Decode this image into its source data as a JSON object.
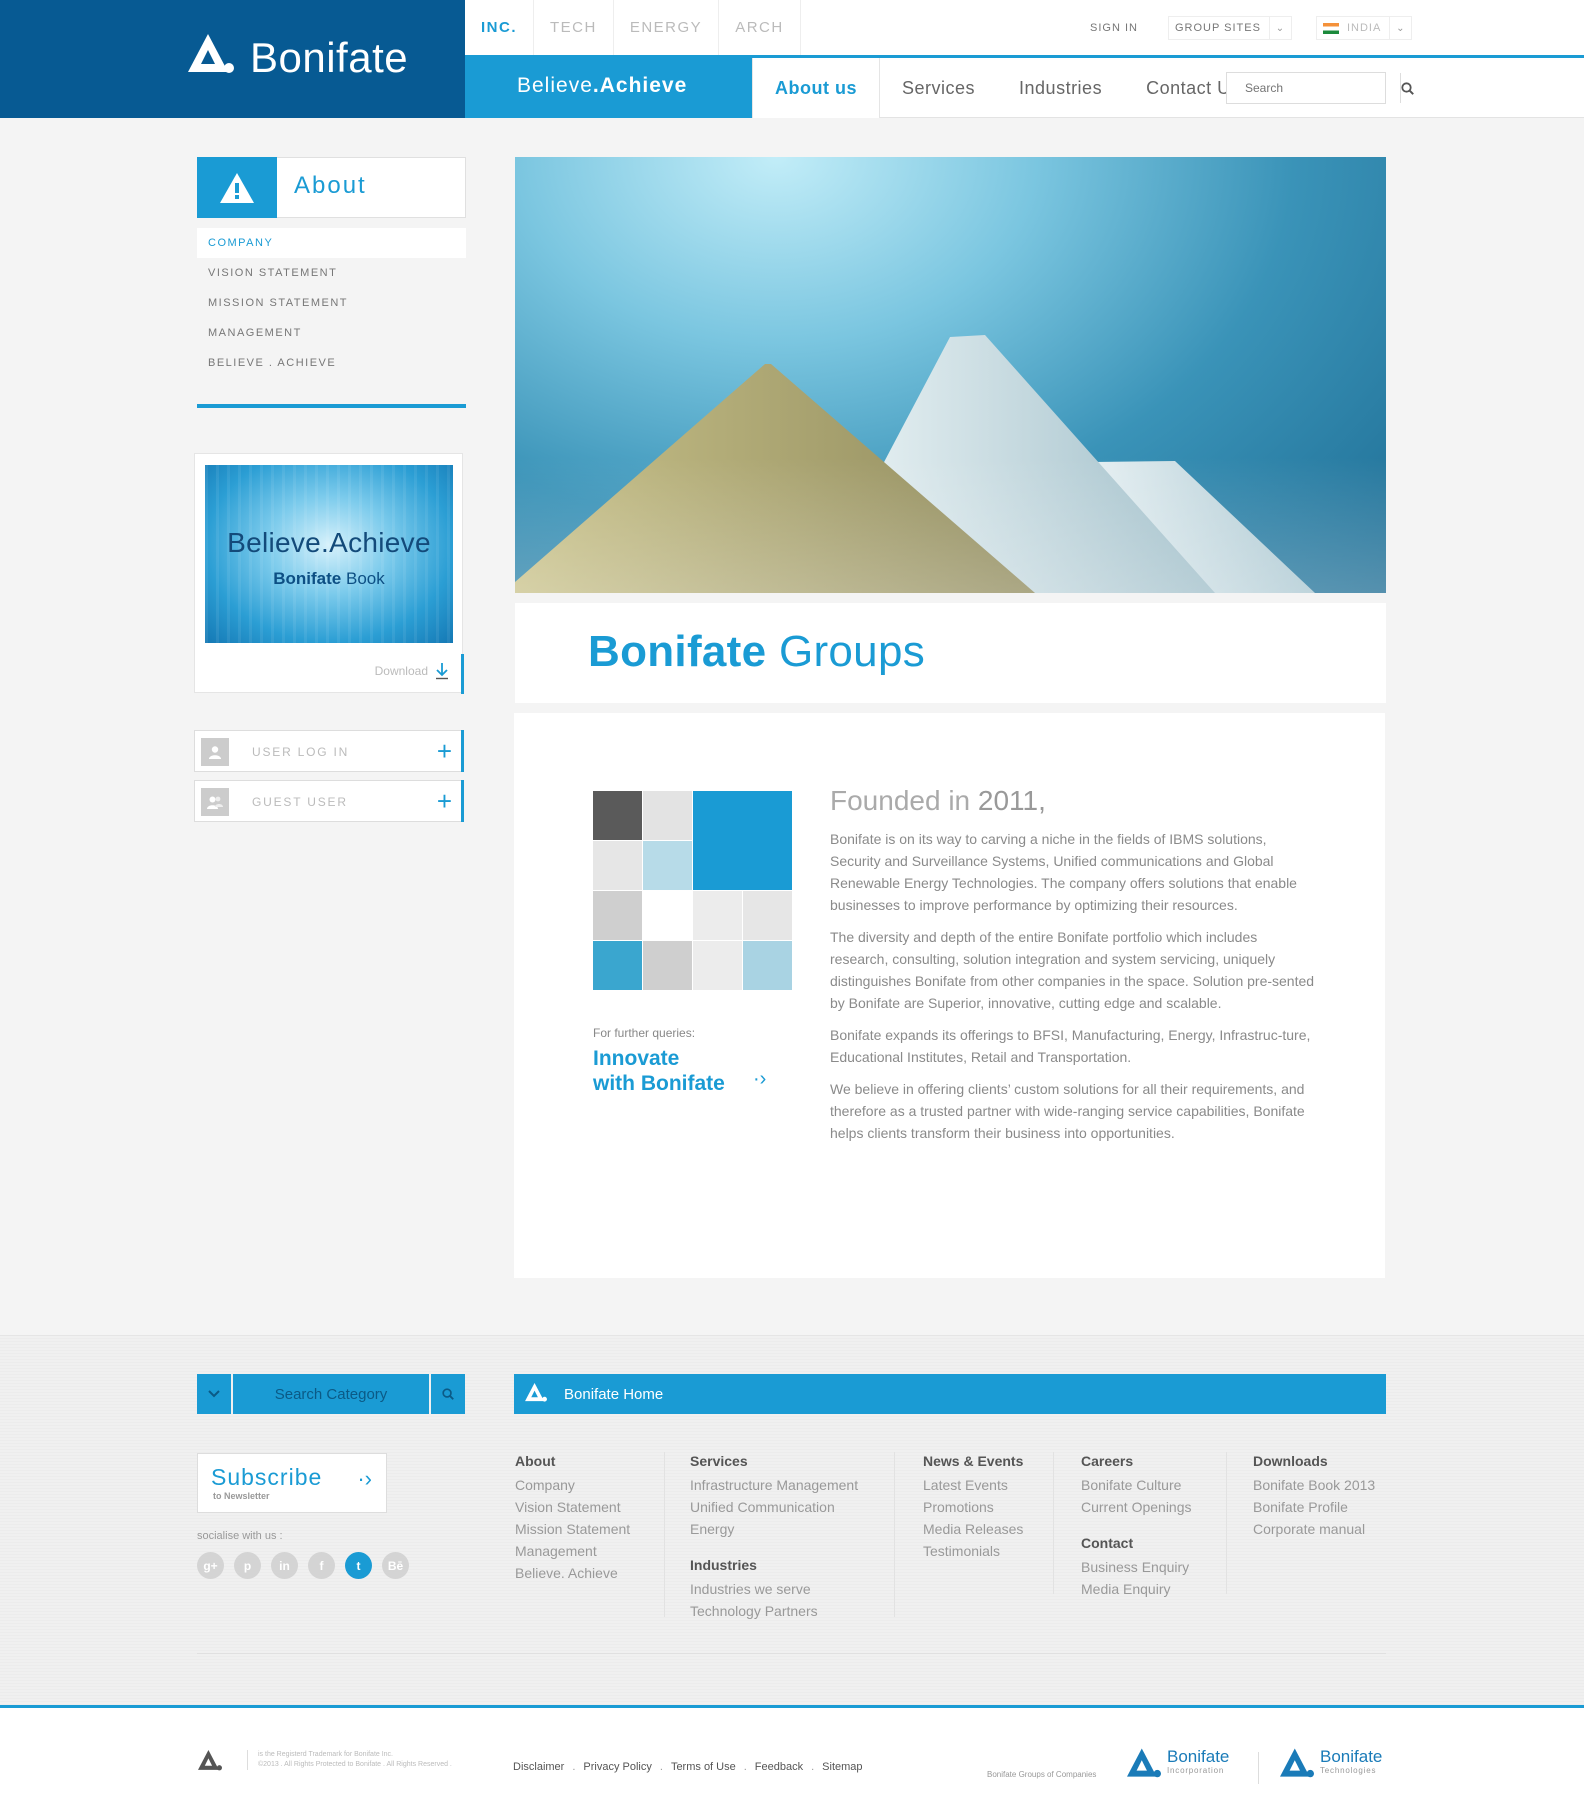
{
  "brand": {
    "name": "Bonifate",
    "tagline_part1": "Believe",
    "tagline_dot": ".",
    "tagline_part2": "Achieve"
  },
  "subsites": [
    "INC.",
    "TECH",
    "ENERGY",
    "ARCH"
  ],
  "utility": {
    "sign_in": "SIGN IN",
    "group_sites": "GROUP SITES",
    "country": "INDIA"
  },
  "nav": [
    "About us",
    "Services",
    "Industries",
    "Contact Us"
  ],
  "search": {
    "placeholder": "Search"
  },
  "sidebar": {
    "title": "About",
    "items": [
      "COMPANY",
      "VISION STATEMENT",
      "MISSION STATEMENT",
      "MANAGEMENT",
      "BELIEVE . ACHIEVE"
    ],
    "book": {
      "title": "Believe.Achieve",
      "subtitle_bold": "Bonifate",
      "subtitle": "Book",
      "download": "Download"
    },
    "login": [
      "USER LOG IN",
      "GUEST USER"
    ]
  },
  "content": {
    "heading_bold": "Bonifate",
    "heading_rest": "Groups",
    "founded_prefix": "Founded in",
    "founded_year": "2011,",
    "queries_label": "For further queries:",
    "queries_line1": "Innovate",
    "queries_line2": "with Bonifate",
    "paragraphs": [
      "Bonifate is on its way to carving a niche in the fields of IBMS solutions, Security and Surveillance Systems, Unified communications and Global Renewable Energy Technologies. The company offers solutions that enable businesses to improve performance by optimizing their resources.",
      "The diversity and depth of the entire Bonifate portfolio which includes research, consulting, solution integration and system servicing, uniquely distinguishes Bonifate from other companies in the space. Solution pre-sented by Bonifate are  Superior, innovative, cutting edge and scalable.",
      "Bonifate expands its offerings to BFSI, Manufacturing, Energy, Infrastruc-ture, Educational Institutes, Retail and Transportation.",
      "We believe in offering clients’ custom solutions for all their requirements, and therefore as a trusted partner with wide-ranging service capabilities, Bonifate helps clients transform their business into opportunities."
    ]
  },
  "footer": {
    "category_search": "Search Category",
    "home_link": "Bonifate Home",
    "subscribe": "Subscribe",
    "subscribe_sub": "to Newsletter",
    "socialise": "socialise with us :",
    "social": [
      "g+",
      "p",
      "in",
      "f",
      "t",
      "Bē"
    ],
    "columns": {
      "about": {
        "title": "About",
        "links": [
          "Company",
          "Vision Statement",
          "Mission Statement",
          "Management",
          "Believe. Achieve"
        ]
      },
      "services": {
        "title": "Services",
        "links": [
          "Infrastructure Management",
          "Unified Communication",
          "Energy"
        ]
      },
      "industries": {
        "title": "Industries",
        "links": [
          "Industries we serve",
          "Technology Partners"
        ]
      },
      "news": {
        "title": "News & Events",
        "links": [
          "Latest Events",
          "Promotions",
          "Media Releases",
          "Testimonials"
        ]
      },
      "careers": {
        "title": "Careers",
        "links": [
          "Bonifate Culture",
          "Current Openings"
        ]
      },
      "contact": {
        "title": "Contact",
        "links": [
          "Business Enquiry",
          "Media Enquiry"
        ]
      },
      "downloads": {
        "title": "Downloads",
        "links": [
          "Bonifate Book 2013",
          "Bonifate Profile",
          "Corporate manual"
        ]
      }
    },
    "legal_line1": "is the Registerd Trademark for Bonifate Inc.",
    "legal_line2": "©2013 . All Rights Protected to Bonifate . All Rights Reserved .",
    "bottom_links": [
      "Disclaimer",
      "Privacy Policy",
      "Terms of Use",
      "Feedback",
      "Sitemap"
    ],
    "groups_label": "Bonifate Groups of Companies",
    "companies": [
      {
        "name": "Bonifate",
        "sub": "Incorporation"
      },
      {
        "name": "Bonifate",
        "sub": "Technologies"
      }
    ]
  },
  "colors": {
    "primary": "#1a9bd4",
    "dark_blue": "#075a93",
    "text_gray": "#8a8a8a"
  }
}
